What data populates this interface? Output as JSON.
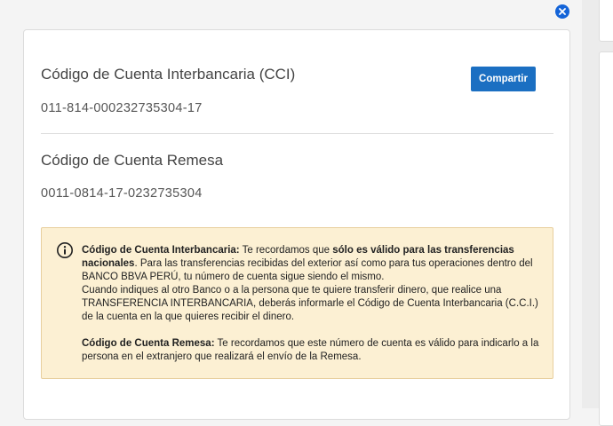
{
  "dialog": {
    "close_icon": "close-icon"
  },
  "cci": {
    "title": "Código de Cuenta Interbancaria (CCI)",
    "number": "011-814-000232735304-17",
    "share_label": "Compartir"
  },
  "remesa": {
    "title": "Código de Cuenta Remesa",
    "number": "0011-0814-17-0232735304"
  },
  "notice": {
    "icon": "info-icon",
    "p1_bold_1": "Código de Cuenta Interbancaria:",
    "p1_text_1": " Te recordamos que ",
    "p1_bold_2": "sólo es válido para las transferencias nacionales",
    "p1_text_2": ". Para las transferencias recibidas del exterior así como para tus operaciones dentro del BANCO BBVA PERÚ, tu número de cuenta sigue siendo el mismo.",
    "p1_text_3": "Cuando indiques al otro Banco o a la persona que te quiere transferir dinero, que realice una TRANSFERENCIA INTERBANCARIA, deberás informarle el Código de Cuenta Interbancaria (C.C.I.) de la cuenta en la que quieres recibir el dinero.",
    "p2_bold": "Código de Cuenta Remesa:",
    "p2_text": " Te recordamos que este número de cuenta es válido para indicarlo a la persona en el extranjero que realizará el envío de la Remesa."
  },
  "colors": {
    "accent": "#1b6fc2",
    "close": "#1464d8",
    "notice_bg": "#fcf0d3",
    "notice_border": "#e8cf9e"
  }
}
